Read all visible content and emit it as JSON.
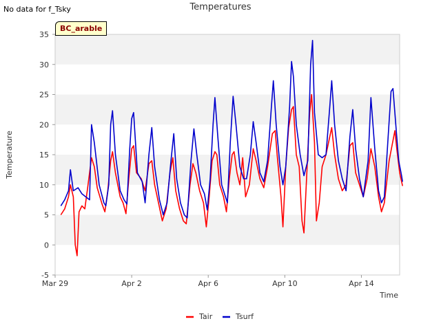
{
  "page": {
    "notice": "No data for f_Tsky",
    "site_label": "BC_arable"
  },
  "chart_data": {
    "type": "line",
    "title": "Temperatures",
    "xlabel": "Time",
    "ylabel": "Temperature",
    "ylim": [
      -5,
      35
    ],
    "yticks": [
      -5,
      0,
      5,
      10,
      15,
      20,
      25,
      30,
      35
    ],
    "xlim_days": [
      0,
      18
    ],
    "xticks": [
      {
        "day": 0,
        "label": "Mar 29"
      },
      {
        "day": 4,
        "label": "Apr 2"
      },
      {
        "day": 8,
        "label": "Apr 6"
      },
      {
        "day": 12,
        "label": "Apr 10"
      },
      {
        "day": 16,
        "label": "Apr 14"
      }
    ],
    "grid": "horizontal bands",
    "legend": "bottom-center",
    "series": [
      {
        "name": "Tair",
        "color": "#ff0000",
        "points": [
          [
            0.3,
            5
          ],
          [
            0.5,
            6
          ],
          [
            0.7,
            8
          ],
          [
            0.8,
            10
          ],
          [
            0.95,
            8
          ],
          [
            1.05,
            0
          ],
          [
            1.15,
            -1.8
          ],
          [
            1.25,
            5.5
          ],
          [
            1.4,
            6.5
          ],
          [
            1.55,
            6
          ],
          [
            1.7,
            9.5
          ],
          [
            1.9,
            14.5
          ],
          [
            2.05,
            13
          ],
          [
            2.2,
            9.5
          ],
          [
            2.45,
            6.8
          ],
          [
            2.6,
            5.5
          ],
          [
            2.75,
            9
          ],
          [
            2.9,
            14
          ],
          [
            3.0,
            15.5
          ],
          [
            3.15,
            12
          ],
          [
            3.4,
            8
          ],
          [
            3.55,
            7
          ],
          [
            3.7,
            5.2
          ],
          [
            3.85,
            11
          ],
          [
            4.0,
            16
          ],
          [
            4.1,
            16.5
          ],
          [
            4.25,
            12
          ],
          [
            4.5,
            11
          ],
          [
            4.7,
            9
          ],
          [
            4.9,
            13.5
          ],
          [
            5.05,
            14
          ],
          [
            5.2,
            10
          ],
          [
            5.4,
            7
          ],
          [
            5.6,
            4
          ],
          [
            5.8,
            6
          ],
          [
            6.0,
            12
          ],
          [
            6.15,
            14.5
          ],
          [
            6.3,
            9
          ],
          [
            6.5,
            6
          ],
          [
            6.7,
            4
          ],
          [
            6.85,
            3.5
          ],
          [
            7.05,
            10
          ],
          [
            7.2,
            13.5
          ],
          [
            7.35,
            12
          ],
          [
            7.55,
            9
          ],
          [
            7.75,
            7
          ],
          [
            7.9,
            3
          ],
          [
            8.05,
            8
          ],
          [
            8.2,
            14
          ],
          [
            8.35,
            15.5
          ],
          [
            8.45,
            15
          ],
          [
            8.6,
            10
          ],
          [
            8.8,
            8
          ],
          [
            8.95,
            5.5
          ],
          [
            9.1,
            11
          ],
          [
            9.25,
            15
          ],
          [
            9.35,
            15.5
          ],
          [
            9.5,
            12
          ],
          [
            9.65,
            10
          ],
          [
            9.8,
            14.5
          ],
          [
            9.95,
            8
          ],
          [
            10.15,
            10
          ],
          [
            10.35,
            16
          ],
          [
            10.5,
            14
          ],
          [
            10.7,
            11
          ],
          [
            10.9,
            9.5
          ],
          [
            11.1,
            13
          ],
          [
            11.35,
            18.5
          ],
          [
            11.5,
            19
          ],
          [
            11.6,
            15
          ],
          [
            11.8,
            8
          ],
          [
            11.9,
            3
          ],
          [
            12.05,
            13
          ],
          [
            12.2,
            19.5
          ],
          [
            12.35,
            22.5
          ],
          [
            12.45,
            23
          ],
          [
            12.6,
            15
          ],
          [
            12.75,
            13
          ],
          [
            12.9,
            4
          ],
          [
            13.0,
            2
          ],
          [
            13.15,
            12
          ],
          [
            13.3,
            22
          ],
          [
            13.4,
            25
          ],
          [
            13.55,
            17
          ],
          [
            13.65,
            4
          ],
          [
            13.8,
            7
          ],
          [
            13.95,
            13
          ],
          [
            14.15,
            15
          ],
          [
            14.35,
            18
          ],
          [
            14.45,
            19.5
          ],
          [
            14.6,
            15
          ],
          [
            14.8,
            11
          ],
          [
            15.0,
            9
          ],
          [
            15.2,
            10
          ],
          [
            15.4,
            16.5
          ],
          [
            15.55,
            17
          ],
          [
            15.7,
            12
          ],
          [
            15.9,
            10
          ],
          [
            16.1,
            8
          ],
          [
            16.3,
            11
          ],
          [
            16.5,
            16
          ],
          [
            16.7,
            13
          ],
          [
            16.9,
            8
          ],
          [
            17.05,
            5.5
          ],
          [
            17.2,
            7
          ],
          [
            17.45,
            14
          ],
          [
            17.6,
            16.5
          ],
          [
            17.75,
            19
          ],
          [
            17.85,
            16
          ],
          [
            18.0,
            12
          ],
          [
            18.15,
            9.8
          ]
        ]
      },
      {
        "name": "Tsurf",
        "color": "#0000cc",
        "points": [
          [
            0.3,
            6.5
          ],
          [
            0.5,
            7.5
          ],
          [
            0.7,
            9
          ],
          [
            0.8,
            12.5
          ],
          [
            0.95,
            9
          ],
          [
            1.2,
            9.5
          ],
          [
            1.4,
            8.5
          ],
          [
            1.6,
            8
          ],
          [
            1.8,
            7.5
          ],
          [
            1.9,
            20
          ],
          [
            2.05,
            17
          ],
          [
            2.3,
            10
          ],
          [
            2.55,
            7
          ],
          [
            2.65,
            6.5
          ],
          [
            2.8,
            10
          ],
          [
            2.9,
            20
          ],
          [
            3.0,
            22.3
          ],
          [
            3.15,
            15
          ],
          [
            3.4,
            9
          ],
          [
            3.6,
            7.5
          ],
          [
            3.75,
            6.8
          ],
          [
            3.9,
            16
          ],
          [
            4.0,
            21
          ],
          [
            4.1,
            22
          ],
          [
            4.3,
            12
          ],
          [
            4.55,
            10.5
          ],
          [
            4.7,
            7
          ],
          [
            4.9,
            15
          ],
          [
            5.05,
            19.5
          ],
          [
            5.2,
            13
          ],
          [
            5.45,
            7.5
          ],
          [
            5.65,
            5
          ],
          [
            5.85,
            7
          ],
          [
            6.05,
            14
          ],
          [
            6.2,
            18.5
          ],
          [
            6.35,
            11
          ],
          [
            6.55,
            7
          ],
          [
            6.75,
            5
          ],
          [
            6.9,
            4.5
          ],
          [
            7.1,
            14
          ],
          [
            7.25,
            19.3
          ],
          [
            7.4,
            15
          ],
          [
            7.6,
            10
          ],
          [
            7.8,
            8.5
          ],
          [
            7.95,
            5.8
          ],
          [
            8.1,
            11
          ],
          [
            8.25,
            20
          ],
          [
            8.35,
            24.5
          ],
          [
            8.5,
            18
          ],
          [
            8.7,
            10
          ],
          [
            8.9,
            8
          ],
          [
            9.0,
            7
          ],
          [
            9.15,
            17
          ],
          [
            9.3,
            24.7
          ],
          [
            9.45,
            20
          ],
          [
            9.65,
            13
          ],
          [
            9.85,
            11
          ],
          [
            10.0,
            11
          ],
          [
            10.2,
            15
          ],
          [
            10.35,
            20.5
          ],
          [
            10.5,
            17
          ],
          [
            10.7,
            12
          ],
          [
            10.9,
            10.5
          ],
          [
            11.1,
            14
          ],
          [
            11.3,
            23
          ],
          [
            11.4,
            27.3
          ],
          [
            11.55,
            20
          ],
          [
            11.75,
            13
          ],
          [
            11.9,
            10
          ],
          [
            12.05,
            13
          ],
          [
            12.25,
            23
          ],
          [
            12.35,
            30.5
          ],
          [
            12.45,
            28
          ],
          [
            12.6,
            20
          ],
          [
            12.8,
            15
          ],
          [
            13.0,
            11.5
          ],
          [
            13.2,
            14
          ],
          [
            13.35,
            30
          ],
          [
            13.45,
            34
          ],
          [
            13.55,
            22
          ],
          [
            13.75,
            15
          ],
          [
            13.95,
            14.5
          ],
          [
            14.15,
            15
          ],
          [
            14.35,
            23
          ],
          [
            14.45,
            27.3
          ],
          [
            14.6,
            20
          ],
          [
            14.8,
            14
          ],
          [
            15.0,
            11
          ],
          [
            15.2,
            9
          ],
          [
            15.4,
            18
          ],
          [
            15.55,
            22.5
          ],
          [
            15.7,
            16
          ],
          [
            15.9,
            11
          ],
          [
            16.1,
            8
          ],
          [
            16.35,
            14
          ],
          [
            16.5,
            24.5
          ],
          [
            16.7,
            16
          ],
          [
            16.9,
            9
          ],
          [
            17.05,
            7
          ],
          [
            17.2,
            8
          ],
          [
            17.4,
            18
          ],
          [
            17.55,
            25.5
          ],
          [
            17.65,
            26
          ],
          [
            17.8,
            20
          ],
          [
            17.95,
            14
          ],
          [
            18.1,
            11.5
          ],
          [
            18.15,
            10.5
          ]
        ]
      }
    ]
  }
}
